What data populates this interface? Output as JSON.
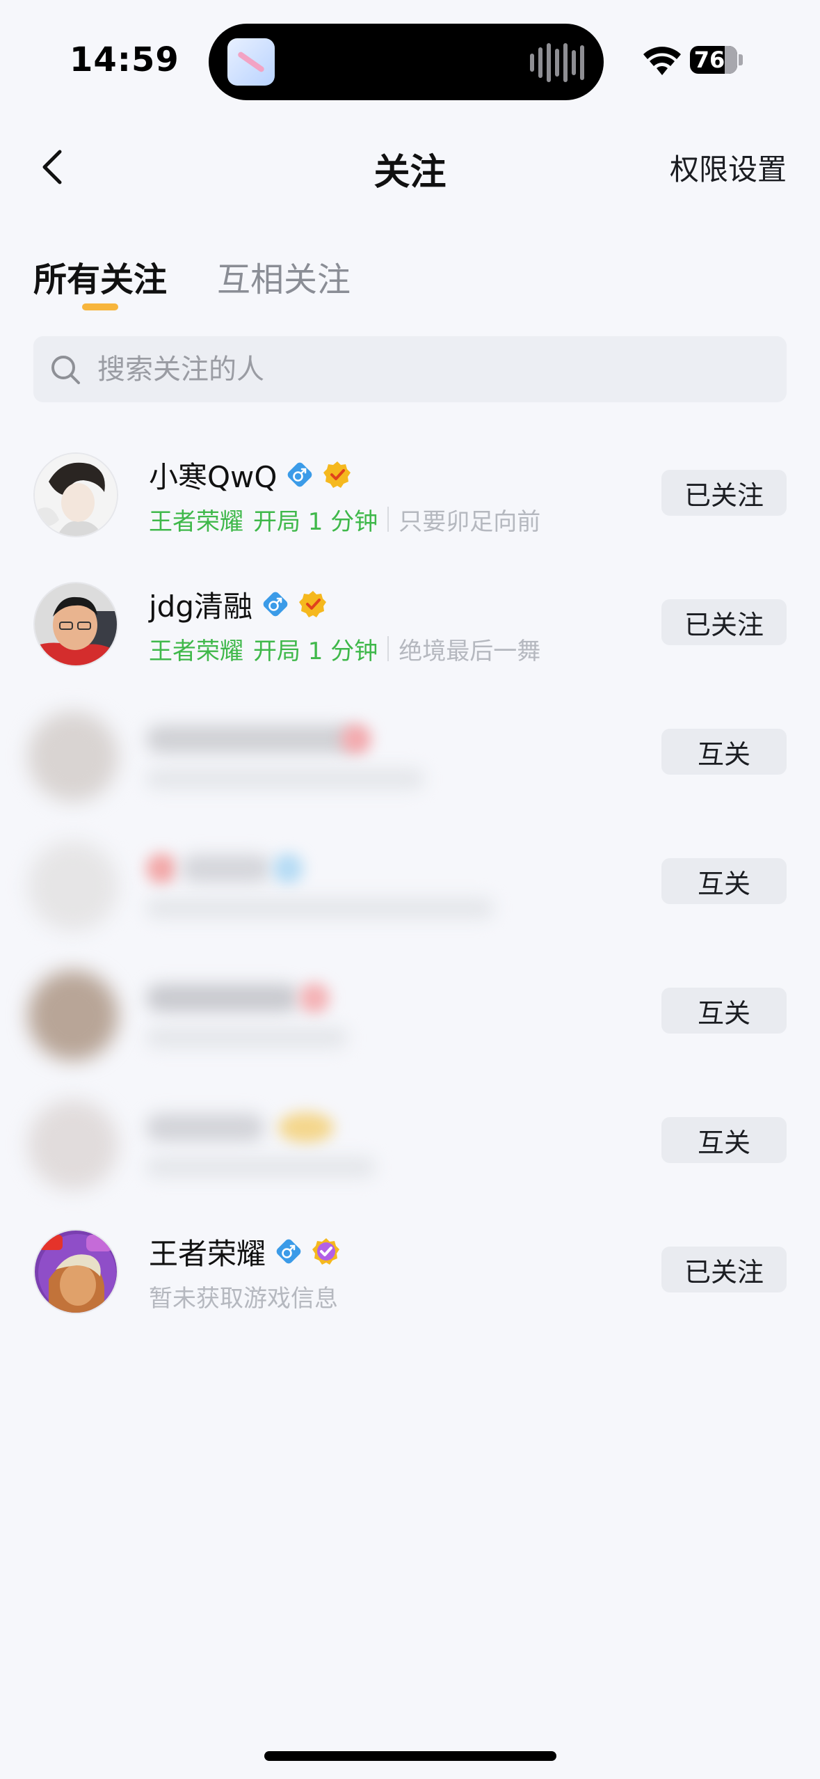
{
  "status_bar": {
    "time": "14:59",
    "battery": "76",
    "battery_fraction": 0.76
  },
  "nav": {
    "title": "关注",
    "permission_label": "权限设置"
  },
  "tabs": [
    {
      "label": "所有关注",
      "active": true
    },
    {
      "label": "互相关注",
      "active": false
    }
  ],
  "search": {
    "placeholder": "搜索关注的人"
  },
  "colors": {
    "accent": "#f7b53c",
    "game_status": "#3fb84a",
    "male_badge": "#3b9be8",
    "verified_gold": "#f5b81e",
    "verified_purple": "#b260e6"
  },
  "list": {
    "items": [
      {
        "name": "小寒QwQ",
        "game": "王者荣耀",
        "status": "开局 1 分钟",
        "signature": "只要卯足向前",
        "button": "已关注",
        "badge": "gold"
      },
      {
        "name": "jdg清融",
        "game": "王者荣耀",
        "status": "开局 1 分钟",
        "signature": "绝境最后一舞",
        "button": "已关注",
        "badge": "gold"
      },
      {
        "button": "互关",
        "blurred": true
      },
      {
        "button": "互关",
        "blurred": true
      },
      {
        "button": "互关",
        "blurred": true
      },
      {
        "button": "互关",
        "blurred": true
      },
      {
        "name": "王者荣耀",
        "info": "暂未获取游戏信息",
        "button": "已关注",
        "badge": "purple"
      }
    ]
  }
}
